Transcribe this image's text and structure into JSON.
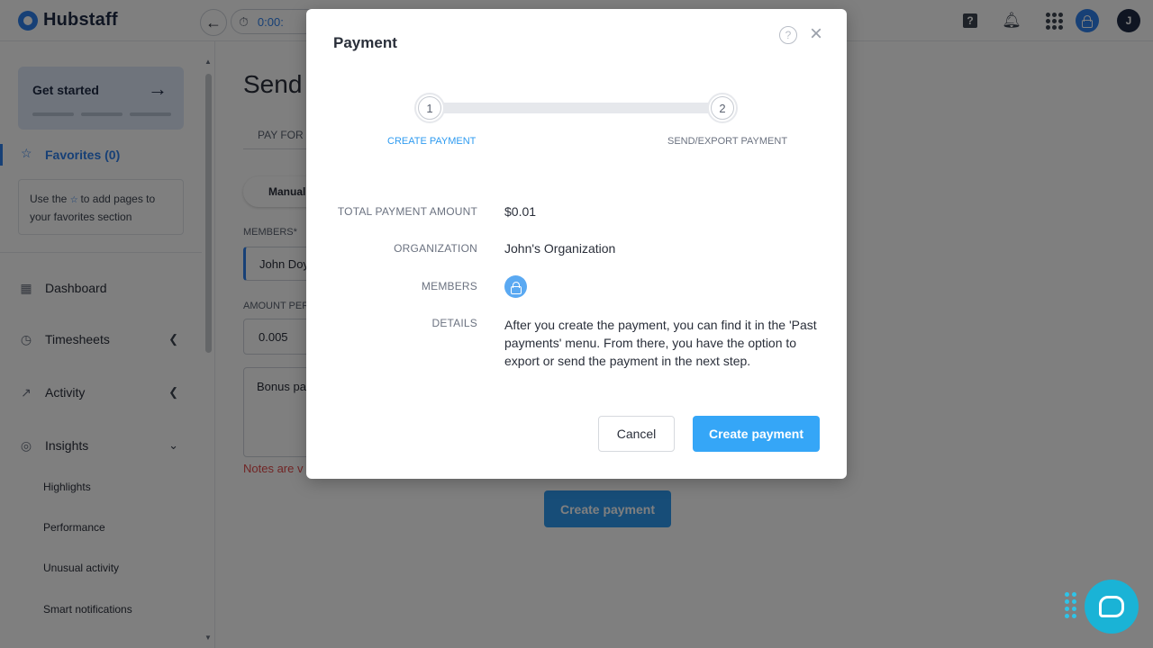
{
  "colors": {
    "accent": "#2f80ed",
    "primary_button": "#35a6f7",
    "warning": "#e34b4b",
    "chat": "#1ab3d6"
  },
  "topbar": {
    "brand": "Hubstaff",
    "timer_text": "0:00:",
    "avatar_initial": "J",
    "icons": [
      "back-arrow-icon",
      "stopwatch-icon",
      "help-square-icon",
      "bell-icon",
      "apps-grid-icon",
      "user-lock-icon"
    ]
  },
  "sidebar": {
    "get_started": "Get started",
    "favorites_label": "Favorites (0)",
    "favorites_hint_before": "Use the",
    "favorites_hint_after": "to add pages to your favorites section",
    "nav": [
      {
        "label": "Dashboard",
        "icon": "dashboard-icon"
      },
      {
        "label": "Timesheets",
        "icon": "clock-icon"
      },
      {
        "label": "Activity",
        "icon": "activity-icon"
      },
      {
        "label": "Insights",
        "icon": "lightbulb-icon"
      }
    ],
    "insights_sub": [
      "Highlights",
      "Performance",
      "Unusual activity",
      "Smart notifications"
    ]
  },
  "page": {
    "title": "Send",
    "tab": "PAY FOR",
    "mode_pill": "Manual",
    "members_label": "MEMBERS*",
    "members_value": "John Doy",
    "amount_label": "AMOUNT PER",
    "amount_value": "0.005",
    "note_value": "Bonus pa",
    "notes_warning": "Notes are v",
    "create_button": "Create payment"
  },
  "modal": {
    "title": "Payment",
    "steps": [
      {
        "number": "1",
        "label": "CREATE PAYMENT",
        "active": true
      },
      {
        "number": "2",
        "label": "SEND/EXPORT PAYMENT",
        "active": false
      }
    ],
    "rows": {
      "total_label": "TOTAL PAYMENT AMOUNT",
      "total_value": "$0.01",
      "org_label": "ORGANIZATION",
      "org_value": "John's Organization",
      "members_label": "MEMBERS",
      "details_label": "DETAILS",
      "details_value": "After you create the payment, you can find it in the 'Past payments' menu. From there, you have the option to export or send the payment in the next step."
    },
    "cancel": "Cancel",
    "create": "Create payment"
  }
}
